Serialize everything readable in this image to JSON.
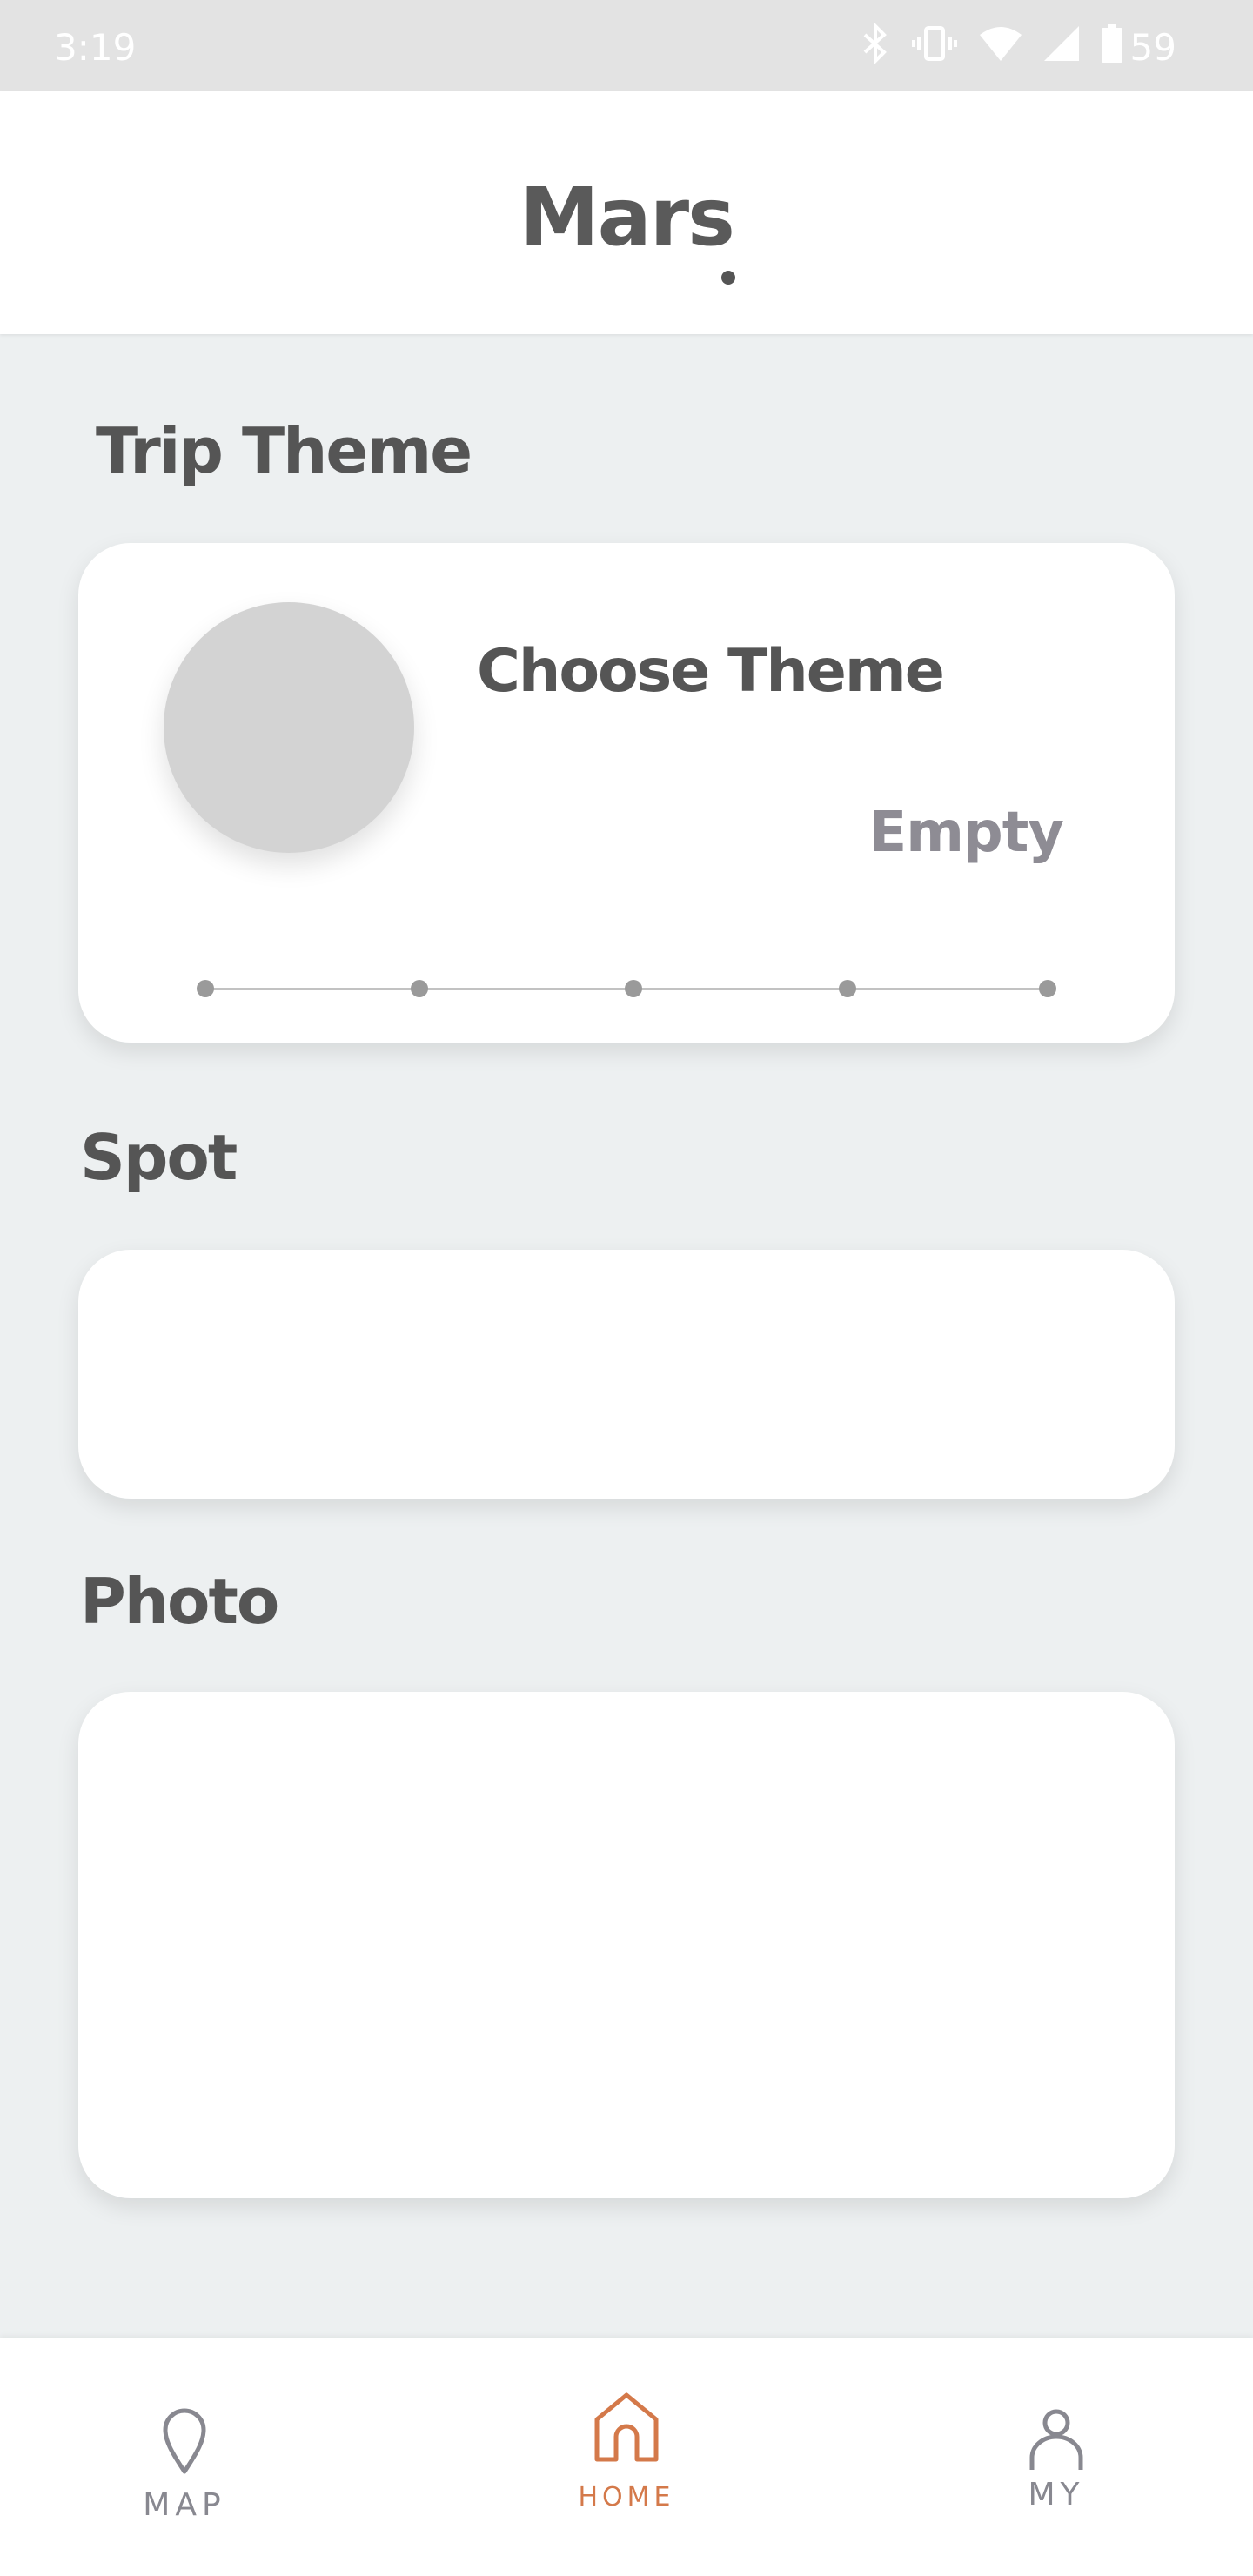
{
  "status_bar": {
    "time": "3:19",
    "battery": "59",
    "icons": [
      "bluetooth-icon",
      "vibrate-icon",
      "wifi-icon",
      "signal-icon",
      "battery-icon"
    ]
  },
  "app_bar": {
    "title": "Mars"
  },
  "sections": {
    "trip_theme": {
      "label": "Trip Theme",
      "card_title": "Choose Theme",
      "card_status": "Empty",
      "step_count": 5
    },
    "spot": {
      "label": "Spot"
    },
    "photo": {
      "label": "Photo"
    }
  },
  "nav": {
    "items": [
      {
        "label": "MAP",
        "icon": "map-pin-icon",
        "active": false
      },
      {
        "label": "HOME",
        "icon": "home-icon",
        "active": true
      },
      {
        "label": "MY",
        "icon": "person-icon",
        "active": false
      }
    ],
    "active_color": "#d4794a",
    "inactive_color": "#888890"
  }
}
